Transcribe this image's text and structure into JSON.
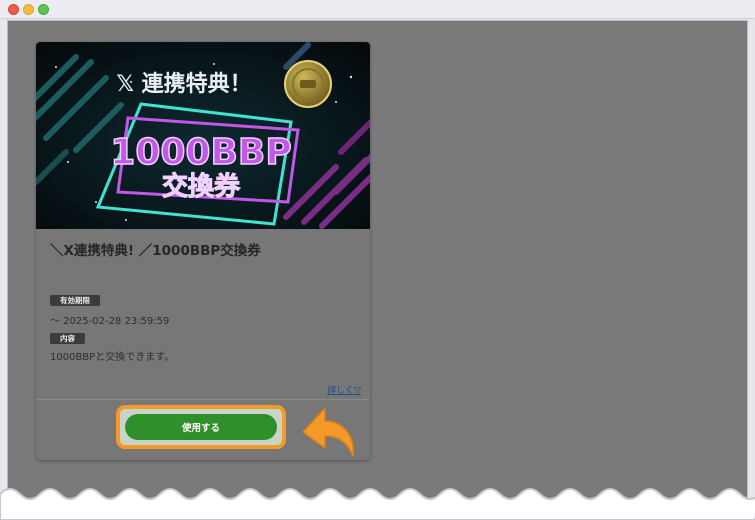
{
  "window": {
    "controls": [
      "close-button",
      "minimize-button",
      "zoom-button"
    ]
  },
  "coupon": {
    "banner": {
      "badge": "𝕏 連携特典！",
      "amount": "1000BBP",
      "type": "交換券"
    },
    "title": "＼X連携特典! ／1000BBP交換券",
    "expiry_label": "有効期限",
    "expiry_value": "～ 2025-02-28 23:59:59",
    "content_label": "内容",
    "content_value": "1000BBPと交換できます。",
    "details_link": "詳しく▽",
    "use_button": "使用する"
  },
  "colors": {
    "button": "#2f8f2b",
    "highlight": "#f39a2a",
    "overlay": "#7a7a7a",
    "banner_neon_teal": "#3fe3d2",
    "banner_neon_purple": "#c158e8"
  },
  "icons": [
    "coin-icon",
    "pointer-arrow-icon"
  ]
}
